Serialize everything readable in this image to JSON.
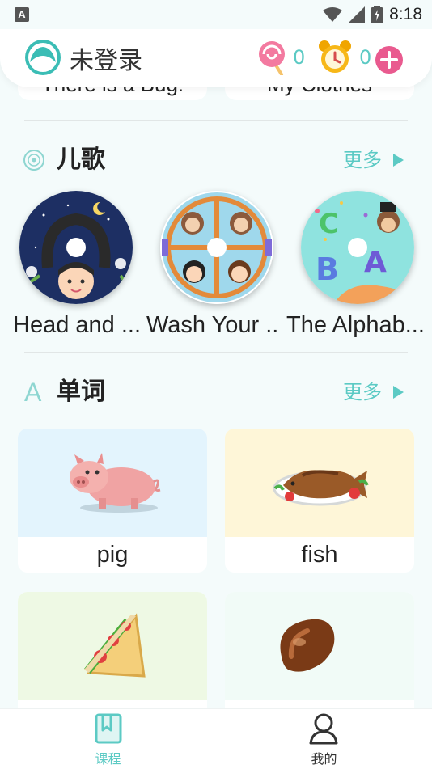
{
  "status_bar": {
    "notification": "A",
    "time": "8:18"
  },
  "header": {
    "login_text": "未登录",
    "candy_count": "0",
    "clock_count": "0"
  },
  "partial_cards": [
    "There is a Bug!",
    "My Clothes"
  ],
  "songs_section": {
    "title": "儿歌",
    "more": "更多",
    "items": [
      {
        "label": "Head and ..."
      },
      {
        "label": "Wash Your ..."
      },
      {
        "label": "The Alphab..."
      }
    ]
  },
  "words_section": {
    "title": "单词",
    "more": "更多",
    "icon_letter": "A",
    "items": [
      {
        "label": "pig"
      },
      {
        "label": "fish"
      },
      {
        "label": ""
      },
      {
        "label": ""
      }
    ]
  },
  "tabbar": {
    "tabs": [
      {
        "label": "课程",
        "active": true
      },
      {
        "label": "我的",
        "active": false
      }
    ]
  },
  "colors": {
    "accent": "#5ccac4",
    "pink": "#e95a8f"
  }
}
